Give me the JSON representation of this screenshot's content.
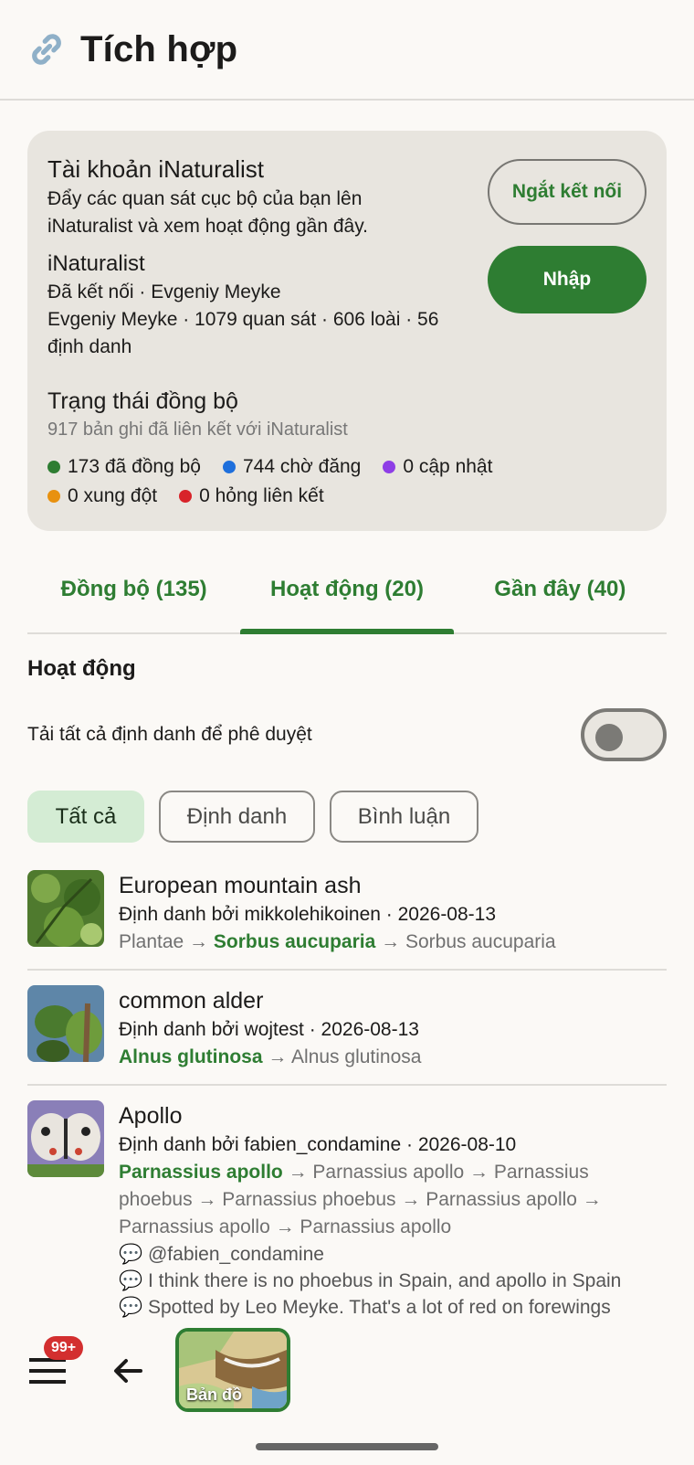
{
  "header": {
    "title": "Tích hợp",
    "icon": "link-icon"
  },
  "card": {
    "title": "Tài khoản iNaturalist",
    "description": "Đẩy các quan sát cục bộ của bạn lên iNaturalist và xem hoạt động gần đây.",
    "service": "iNaturalist",
    "status_line": "Đã kết nối · Evgeniy Meyke",
    "stats_line": "Evgeniy Meyke · 1079 quan sát · 606 loài · 56 định danh",
    "disconnect_label": "Ngắt kết nối",
    "import_label": "Nhập",
    "sync_title": "Trạng thái đồng bộ",
    "sync_subtitle": "917 bản ghi đã liên kết với iNaturalist",
    "legend": [
      {
        "label": "173 đã đồng bộ",
        "color": "#2e7d32"
      },
      {
        "label": "744 chờ đăng",
        "color": "#1e6fdc"
      },
      {
        "label": "0 cập nhật",
        "color": "#8e3ee6"
      },
      {
        "label": "0 xung đột",
        "color": "#e8910f"
      },
      {
        "label": "0 hỏng liên kết",
        "color": "#d8232a"
      }
    ]
  },
  "tabs": [
    {
      "label": "Đồng bộ (135)",
      "active": false
    },
    {
      "label": "Hoạt động (20)",
      "active": true
    },
    {
      "label": "Gần đây (40)",
      "active": false
    }
  ],
  "activity": {
    "title": "Hoạt động",
    "toggle_label": "Tải tất cả định danh để phê duyệt",
    "toggle_on": false,
    "filters": [
      "Tất cả",
      "Định danh",
      "Bình luận"
    ]
  },
  "items": [
    {
      "name": "European mountain ash",
      "meta": "Định danh bởi mikkolehikoinen · 2026-08-13",
      "tax_prefix": "Plantae →",
      "tax_first": "Sorbus aucuparia",
      "tax_rest": "→ Sorbus aucuparia",
      "comments": []
    },
    {
      "name": "common alder",
      "meta": "Định danh bởi wojtest · 2026-08-13",
      "tax_prefix": "",
      "tax_first": "Alnus glutinosa",
      "tax_rest": "→ Alnus glutinosa",
      "comments": []
    },
    {
      "name": "Apollo",
      "meta": "Định danh bởi fabien_condamine · 2026-08-10",
      "tax_prefix": "",
      "tax_first": "Parnassius apollo",
      "tax_rest": "→ Parnassius apollo → Parnassius phoebus → Parnassius phoebus → Parnassius apollo → Parnassius apollo → Parnassius apollo",
      "comments": [
        "💬 @fabien_condamine",
        "💬 I think there is no phoebus in Spain, and apollo in Spain",
        "💬 Spotted by Leo Meyke. That's a lot of red on forewings"
      ]
    }
  ],
  "bottom": {
    "badge": "99+",
    "map_label": "Bản đồ"
  }
}
